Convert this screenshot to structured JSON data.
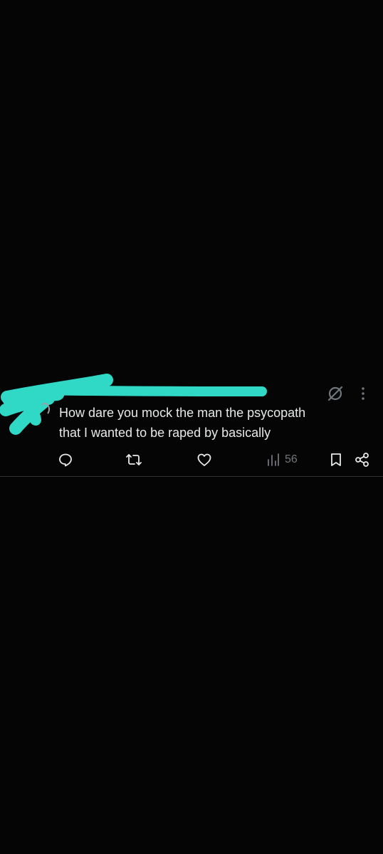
{
  "post": {
    "text": "How dare you mock the man the psycopath\nthat I wanted to be raped by basically",
    "views_count": "56"
  },
  "icons": {
    "grok": "grok-icon",
    "more": "more-vertical-icon",
    "reply": "reply-icon",
    "repost": "repost-icon",
    "like": "like-heart-icon",
    "views": "views-chart-icon",
    "bookmark": "bookmark-icon",
    "share": "share-icon"
  },
  "colors": {
    "background": "#050505",
    "text": "#e7e9ea",
    "muted": "#71767b",
    "redaction": "#2fd9c6",
    "divider": "#2f3336"
  }
}
